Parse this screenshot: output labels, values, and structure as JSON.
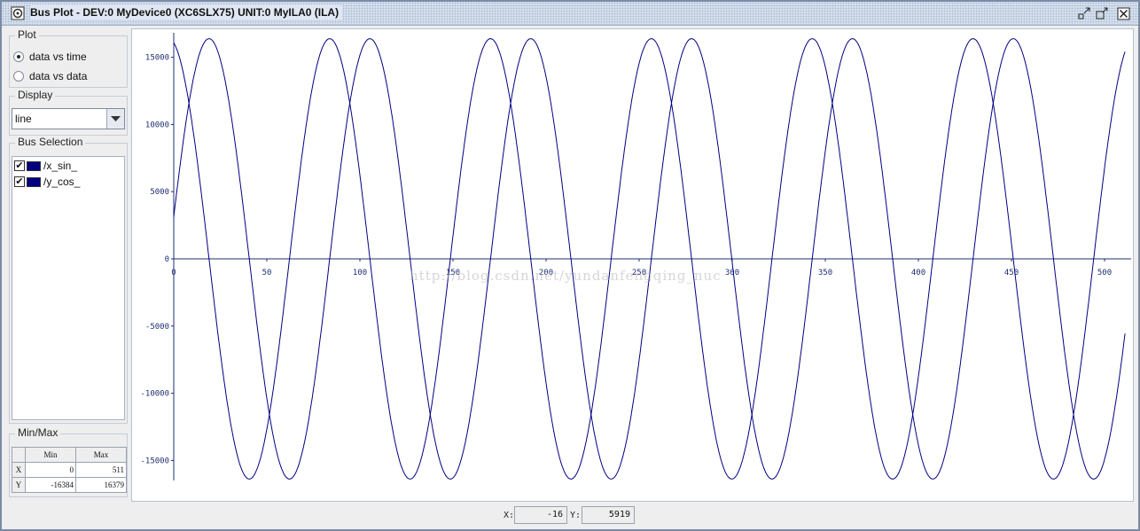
{
  "window": {
    "title": "Bus Plot - DEV:0 MyDevice0 (XC6SLX75) UNIT:0 MyILA0 (ILA)"
  },
  "plot_group": {
    "title": "Plot",
    "options": [
      {
        "label": "data vs time",
        "selected": true
      },
      {
        "label": "data vs data",
        "selected": false
      }
    ]
  },
  "display_group": {
    "title": "Display",
    "value": "line"
  },
  "bus_selection": {
    "title": "Bus Selection",
    "items": [
      {
        "label": "/x_sin_",
        "checked": true,
        "color": "#000080"
      },
      {
        "label": "/y_cos_",
        "checked": true,
        "color": "#000080"
      }
    ]
  },
  "minmax": {
    "title": "Min/Max",
    "headers": [
      "Min",
      "Max"
    ],
    "rows": [
      {
        "label": "X",
        "min": "0",
        "max": "511"
      },
      {
        "label": "Y",
        "min": "-16384",
        "max": "16379"
      }
    ]
  },
  "watermark": "http://blog.csdn.net/yundanfengqing_nuc",
  "readout": {
    "x_label": "X:",
    "x_value": "-16",
    "y_label": "Y:",
    "y_value": "5919"
  },
  "colors": {
    "series": "#000080",
    "axis": "#1f2f72"
  },
  "chart_data": {
    "type": "line",
    "title": "",
    "xlabel": "",
    "ylabel": "",
    "xlim": [
      0,
      512
    ],
    "ylim": [
      -16384,
      16384
    ],
    "x_ticks": [
      0,
      50,
      100,
      150,
      200,
      250,
      300,
      350,
      400,
      450,
      500
    ],
    "y_ticks": [
      15000,
      10000,
      5000,
      0,
      -5000,
      -10000,
      -15000
    ],
    "grid": false,
    "series": [
      {
        "name": "/x_sin_",
        "shape": "sine",
        "amplitude": 16384,
        "period_samples": 86.4,
        "phase_deg": 11,
        "x_range": [
          0,
          511
        ]
      },
      {
        "name": "/y_cos_",
        "shape": "cosine",
        "amplitude": 16384,
        "period_samples": 86.4,
        "phase_deg": 11,
        "x_range": [
          0,
          511
        ]
      }
    ]
  }
}
